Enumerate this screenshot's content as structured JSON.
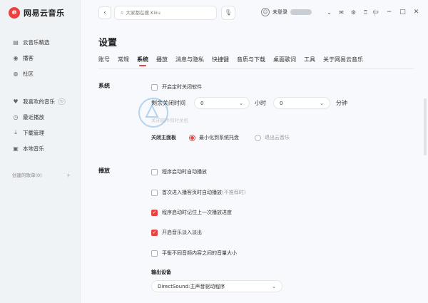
{
  "app": {
    "logo_char": "e",
    "name": "网易云音乐"
  },
  "sidebar": {
    "items_top": [
      {
        "label": "云音乐精选",
        "icon": "music-library-icon"
      },
      {
        "label": "播客",
        "icon": "podcast-icon"
      },
      {
        "label": "社区",
        "icon": "community-icon"
      }
    ],
    "items_my": [
      {
        "label": "我喜欢的音乐",
        "icon": "heart-icon"
      },
      {
        "label": "最近播放",
        "icon": "clock-icon"
      },
      {
        "label": "下载管理",
        "icon": "download-icon"
      },
      {
        "label": "本地音乐",
        "icon": "local-music-icon"
      }
    ],
    "created_playlists": "创建的歌单(0)"
  },
  "topbar": {
    "search_placeholder": "大家都在搜 Kiiiu",
    "user_label": "未登录"
  },
  "settings": {
    "title": "设置",
    "tabs": [
      "账号",
      "常规",
      "系统",
      "播放",
      "消息与隐私",
      "快捷键",
      "音质与下载",
      "桌面歌词",
      "工具",
      "关于网易云音乐"
    ],
    "active_tab": "系统",
    "system": {
      "label": "系统",
      "timer_checkbox": "开启定时关闭软件",
      "remaining_label": "剩余关闭时间",
      "hour_value": "0",
      "hour_unit": "小时",
      "minute_value": "0",
      "minute_unit": "分钟",
      "faded_text": "关闭软件同时关机",
      "close_panel_label": "关闭主面板",
      "close_options": [
        "最小化到系统托盘",
        "退出云音乐"
      ],
      "close_selected": 0
    },
    "playback": {
      "label": "播放",
      "options": [
        {
          "text": "程序启动时自动播放",
          "checked": false
        },
        {
          "text": "首次进入播客页时自动播放",
          "suffix": "(不推荐时)",
          "checked": false
        },
        {
          "text": "程序启动时记住上一次播放进度",
          "checked": true
        },
        {
          "text": "开启音乐淡入淡出",
          "checked": true
        },
        {
          "text": "平衡不同音频内容之间的音量大小",
          "checked": false
        }
      ],
      "output_device_label": "输出设备",
      "output_device_value": "DirectSound:主声音驱动程序"
    }
  },
  "colors": {
    "accent": "#ec4141",
    "background": "#f7f9fc",
    "sidebar": "#f0f3f6"
  }
}
